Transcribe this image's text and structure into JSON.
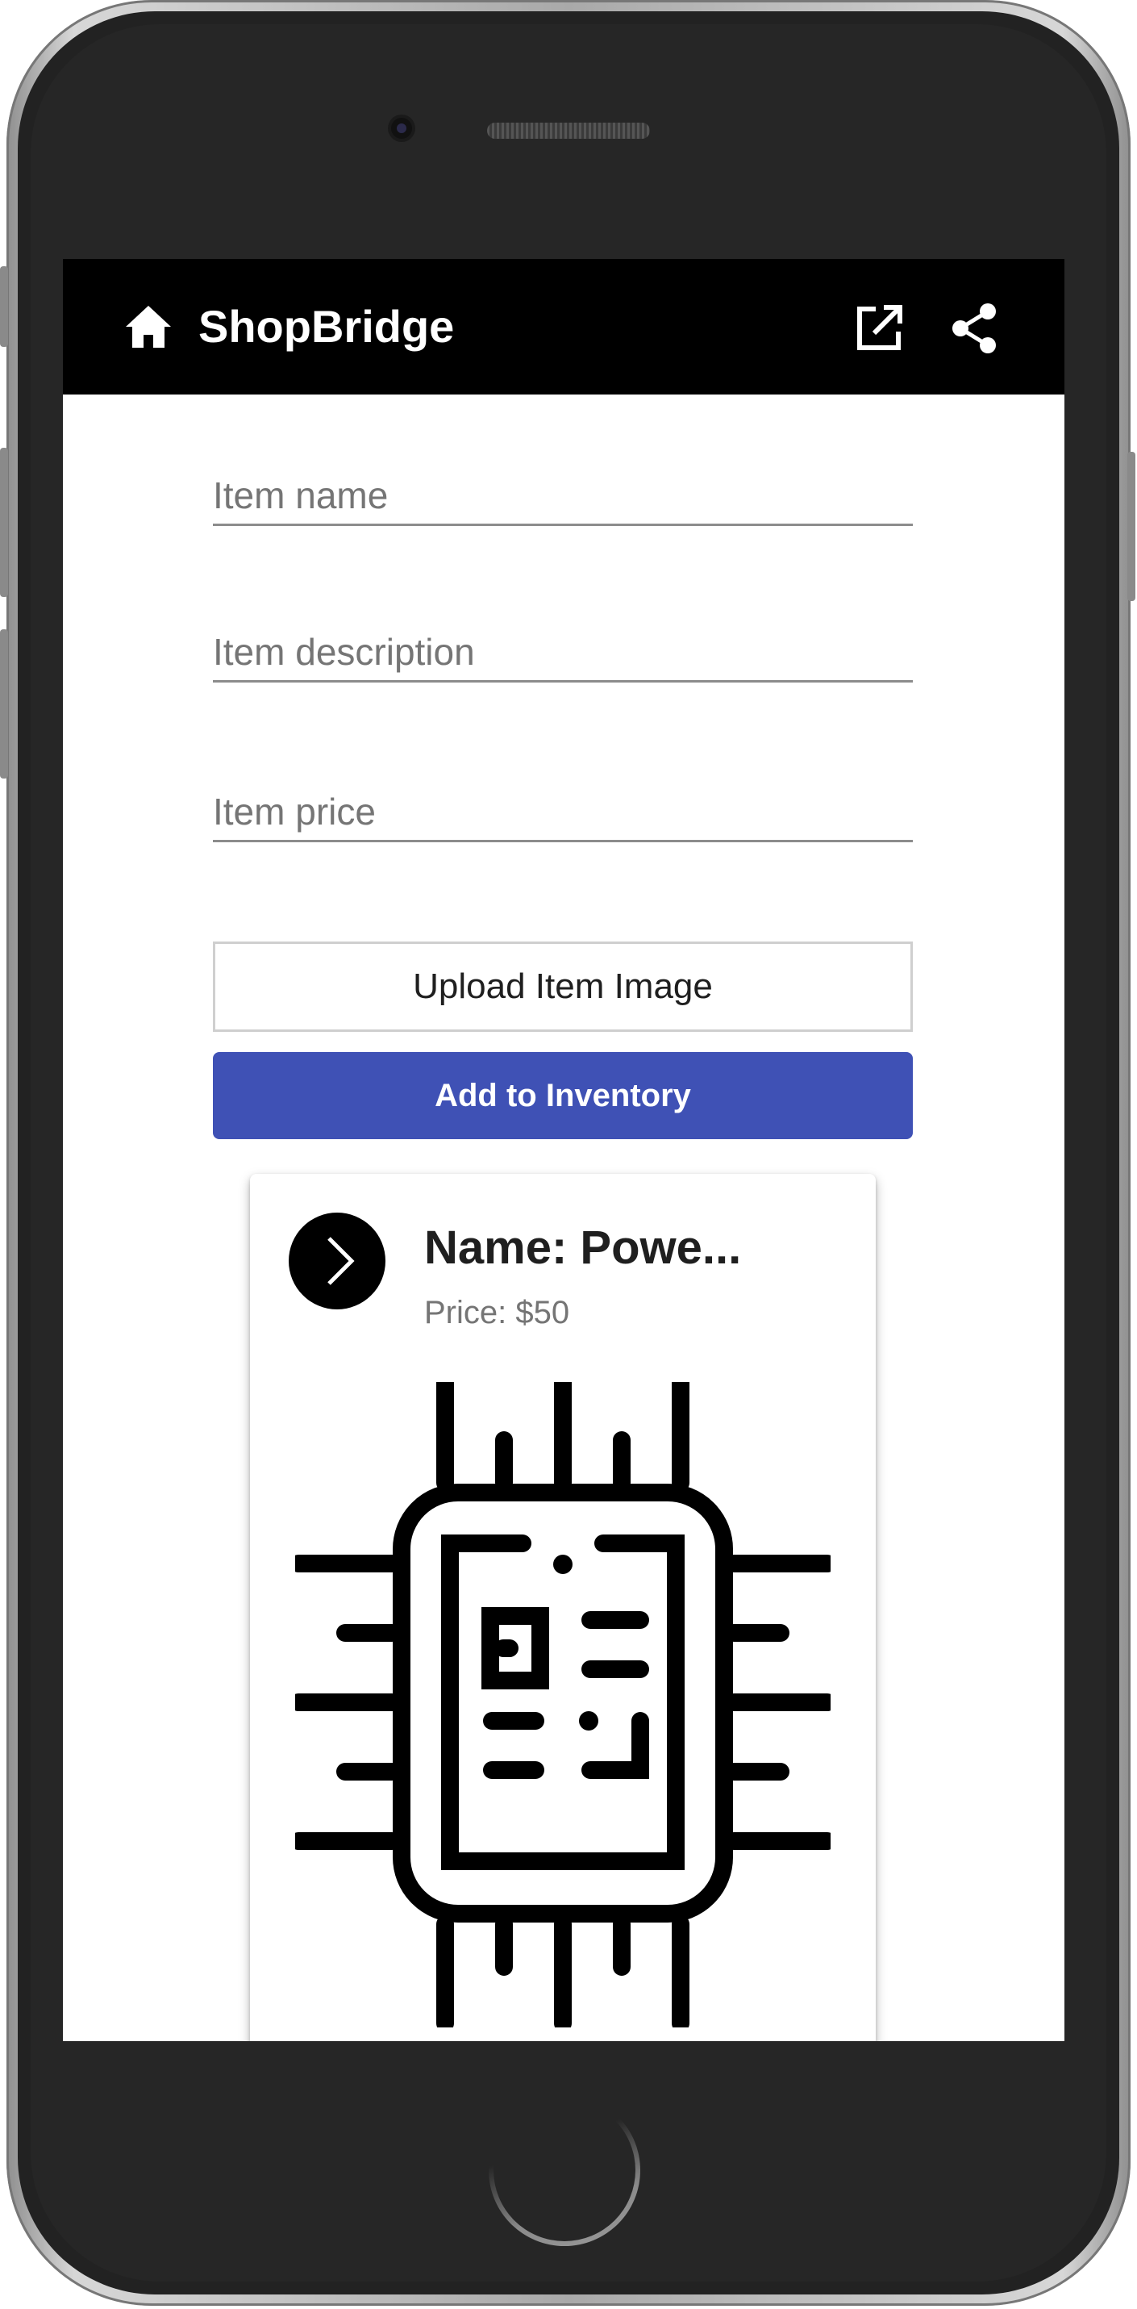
{
  "app": {
    "title": "ShopBridge",
    "icons": {
      "home": "home-icon",
      "open": "open-in-new-icon",
      "share": "share-icon"
    }
  },
  "form": {
    "item_name_placeholder": "Item name",
    "item_description_placeholder": "Item description",
    "item_price_placeholder": "Item price",
    "upload_label": "Upload Item Image",
    "add_label": "Add to Inventory"
  },
  "card": {
    "title": "Name: Powe...",
    "price": "Price: $50",
    "avatar_icon": "chevron-right-icon",
    "image_icon": "cpu-chip-icon"
  },
  "colors": {
    "appbar": "#000000",
    "primary": "#3f51b5",
    "placeholder": "#757575"
  }
}
